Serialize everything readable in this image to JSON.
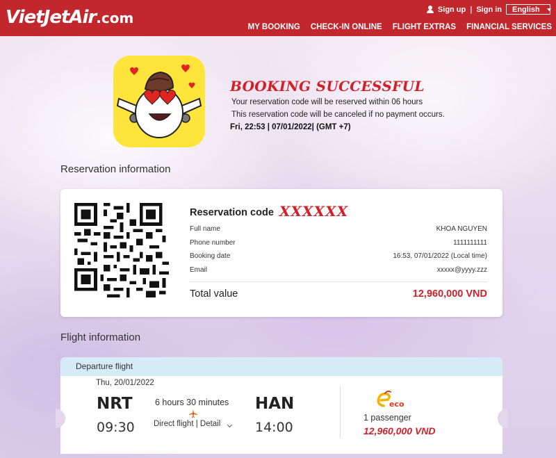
{
  "header": {
    "logo_main": "VietJetAir",
    "logo_suffix": ".com",
    "sign_up": "Sign up",
    "separator": "|",
    "sign_in": "Sign in",
    "language": "English",
    "nav": [
      "MY BOOKING",
      "CHECK-IN ONLINE",
      "FLIGHT EXTRAS",
      "FINANCIAL SERVICES"
    ]
  },
  "hero": {
    "title": "BOOKING SUCCESSFUL",
    "line1": "Your reservation code will be reserved within 06 hours",
    "line2": "This reservation code will be canceled if no payment occurs.",
    "timestamp": "Fri, 22:53 | 07/01/2022| (GMT +7)"
  },
  "reservation": {
    "section_title": "Reservation information",
    "code_label": "Reservation code",
    "code_value": "XXXXXX",
    "rows": [
      {
        "label": "Full name",
        "value": "KHOA NGUYEN"
      },
      {
        "label": "Phone number",
        "value": "1111111111"
      },
      {
        "label": "Booking date",
        "value": "16:53, 07/01/2022 (Local time)"
      },
      {
        "label": "Email",
        "value": "xxxxx@yyyy.zzz"
      }
    ],
    "total_label": "Total value",
    "total_value": "12,960,000 VND"
  },
  "flight": {
    "section_title": "Flight information",
    "bar_label": "Departure flight",
    "date": "Thu, 20/01/2022",
    "from_code": "NRT",
    "from_time": "09:30",
    "to_code": "HAN",
    "to_time": "14:00",
    "duration": "6 hours 30 minutes",
    "direct": "Direct flight | Detail",
    "fare_class": "eco",
    "passengers": "1 passenger",
    "price": "12,960,000 VND"
  },
  "colors": {
    "brand_red": "#c1272d",
    "accent_red": "#d0212a",
    "departure_bar": "#d5ecf7",
    "mascot_bg": "#ffe53b"
  }
}
